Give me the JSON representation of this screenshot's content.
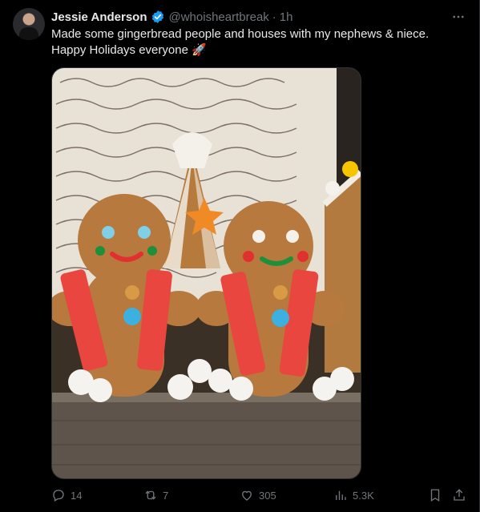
{
  "post": {
    "author_name": "Jessie Anderson",
    "author_handle": "@whoisheartbreak",
    "separator": "·",
    "time": "1h",
    "text_line1": "Made some gingerbread people and houses with my nephews & niece.",
    "text_line2": "Happy Holidays everyone 🚀"
  },
  "actions": {
    "replies": "14",
    "reposts": "7",
    "likes": "305",
    "views": "5.3K"
  },
  "colors": {
    "background": "#000000",
    "text": "#e7e9ea",
    "muted": "#71767b",
    "verified": "#1d9bf0"
  },
  "icons": [
    "more-icon",
    "verified-icon",
    "reply-icon",
    "repost-icon",
    "like-icon",
    "views-icon",
    "bookmark-icon",
    "share-icon"
  ]
}
